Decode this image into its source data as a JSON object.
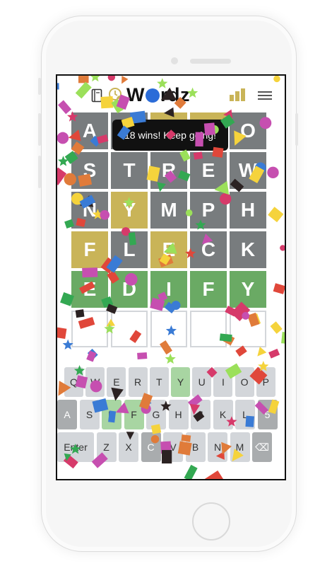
{
  "app": {
    "title": "Wordz",
    "title_left": "W",
    "title_right": "rdz"
  },
  "header": {
    "book_icon": "book-icon",
    "clock_icon": "clock-check-icon",
    "stats_icon": "bar-chart-icon",
    "menu_icon": "hamburger-menu-icon",
    "accent": "#c9b458"
  },
  "toast": {
    "text": "18 wins! Keep going!"
  },
  "board": {
    "rows": [
      [
        {
          "l": "A",
          "s": "g"
        },
        {
          "l": "",
          "s": "g"
        },
        {
          "l": "",
          "s": "y"
        },
        {
          "l": "",
          "s": "y"
        },
        {
          "l": "O",
          "s": "g"
        }
      ],
      [
        {
          "l": "S",
          "s": "g"
        },
        {
          "l": "T",
          "s": "g"
        },
        {
          "l": "R",
          "s": "g"
        },
        {
          "l": "E",
          "s": "g"
        },
        {
          "l": "W",
          "s": "g"
        }
      ],
      [
        {
          "l": "N",
          "s": "g"
        },
        {
          "l": "Y",
          "s": "y"
        },
        {
          "l": "M",
          "s": "g"
        },
        {
          "l": "P",
          "s": "g"
        },
        {
          "l": "H",
          "s": "g"
        }
      ],
      [
        {
          "l": "F",
          "s": "y"
        },
        {
          "l": "L",
          "s": "g"
        },
        {
          "l": "E",
          "s": "y"
        },
        {
          "l": "C",
          "s": "g"
        },
        {
          "l": "K",
          "s": "g"
        }
      ],
      [
        {
          "l": "E",
          "s": "gr"
        },
        {
          "l": "D",
          "s": "gr"
        },
        {
          "l": "I",
          "s": "gr"
        },
        {
          "l": "F",
          "s": "gr"
        },
        {
          "l": "Y",
          "s": "gr"
        }
      ],
      [
        {
          "l": "",
          "s": "e"
        },
        {
          "l": "",
          "s": "e"
        },
        {
          "l": "",
          "s": "e"
        },
        {
          "l": "",
          "s": "e"
        },
        {
          "l": "",
          "s": "e"
        }
      ]
    ]
  },
  "keyboard": {
    "row1": [
      {
        "k": "Q",
        "s": ""
      },
      {
        "k": "W",
        "s": ""
      },
      {
        "k": "E",
        "s": ""
      },
      {
        "k": "R",
        "s": ""
      },
      {
        "k": "T",
        "s": ""
      },
      {
        "k": "Y",
        "s": "green"
      },
      {
        "k": "U",
        "s": ""
      },
      {
        "k": "I",
        "s": ""
      },
      {
        "k": "O",
        "s": ""
      },
      {
        "k": "P",
        "s": ""
      }
    ],
    "row2": [
      {
        "k": "A",
        "s": "gray"
      },
      {
        "k": "S",
        "s": ""
      },
      {
        "k": "D",
        "s": "green"
      },
      {
        "k": "F",
        "s": "green"
      },
      {
        "k": "G",
        "s": ""
      },
      {
        "k": "H",
        "s": ""
      },
      {
        "k": "J",
        "s": ""
      },
      {
        "k": "K",
        "s": ""
      },
      {
        "k": "L",
        "s": ""
      },
      {
        "k": "5",
        "s": "gray"
      }
    ],
    "row3": [
      {
        "k": "Enter",
        "s": ""
      },
      {
        "k": "Z",
        "s": ""
      },
      {
        "k": "X",
        "s": ""
      },
      {
        "k": "C",
        "s": "gray"
      },
      {
        "k": "V",
        "s": ""
      },
      {
        "k": "B",
        "s": ""
      },
      {
        "k": "N",
        "s": ""
      },
      {
        "k": "M",
        "s": ""
      },
      {
        "k": "⌫",
        "s": "gray"
      }
    ]
  },
  "colors": {
    "correct": "#6aaa64",
    "present": "#c9b458",
    "absent": "#787c7e"
  }
}
